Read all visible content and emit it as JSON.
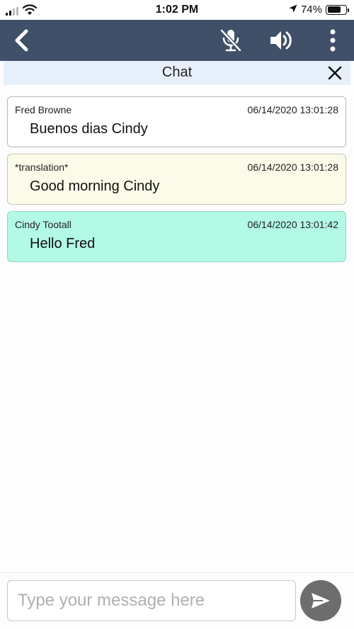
{
  "status_bar": {
    "time": "1:02 PM",
    "battery_text": "74%",
    "battery_level": 0.74,
    "icons": [
      "cellular-signal-icon",
      "wifi-icon",
      "location-arrow-icon",
      "battery-icon"
    ]
  },
  "toolbar": {
    "background": "#3f5068",
    "icons": [
      "back-chevron-icon",
      "microphone-muted-icon",
      "speaker-icon",
      "more-vertical-icon"
    ]
  },
  "chat": {
    "title": "Chat",
    "close_icon": "close-icon",
    "header_background": "#e6f0fb",
    "messages": [
      {
        "sender": "Fred Browne",
        "timestamp": "06/14/2020 13:01:28",
        "text": "Buenos dias Cindy",
        "kind": "received",
        "color": "#ffffff"
      },
      {
        "sender": "*translation*",
        "timestamp": "06/14/2020 13:01:28",
        "text": "Good morning Cindy",
        "kind": "translation",
        "color": "#fcfbe9"
      },
      {
        "sender": "Cindy Tootall",
        "timestamp": "06/14/2020 13:01:42",
        "text": "Hello Fred",
        "kind": "own",
        "color": "#b2f9e6"
      }
    ]
  },
  "composer": {
    "placeholder": "Type your message here",
    "value": "",
    "send_icon": "send-icon",
    "send_button_color": "#6d6d6d"
  }
}
